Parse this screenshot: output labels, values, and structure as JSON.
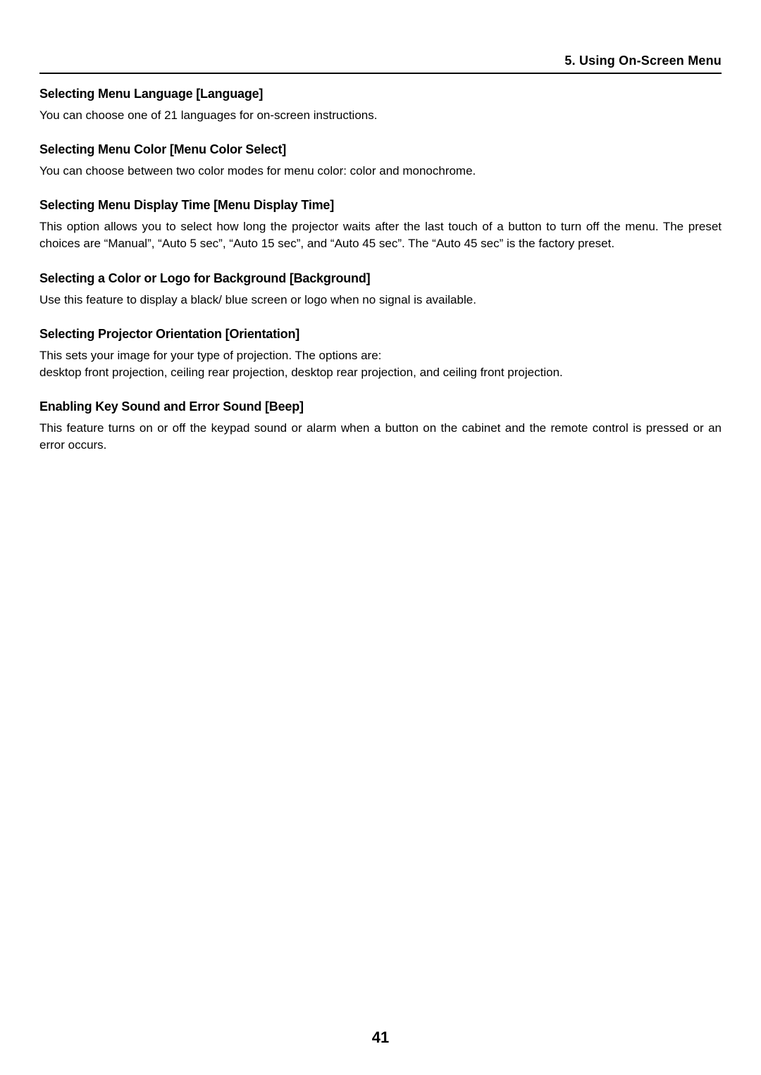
{
  "header": {
    "chapter": "5. Using On-Screen Menu"
  },
  "sections": [
    {
      "heading": "Selecting Menu Language [Language]",
      "body": "You can choose one of 21 languages for on-screen instructions."
    },
    {
      "heading": "Selecting Menu Color [Menu Color Select]",
      "body": "You can choose between two color modes for menu color: color and monochrome."
    },
    {
      "heading": "Selecting Menu Display Time [Menu Display Time]",
      "body": "This option allows you to select how long the projector waits after the last touch of a button to turn off the menu. The preset choices are “Manual”, “Auto 5 sec”, “Auto 15 sec”, and “Auto 45 sec”. The “Auto 45 sec” is the factory preset."
    },
    {
      "heading": "Selecting a Color or Logo for Background [Background]",
      "body": "Use this feature to display a black/ blue screen or logo when no signal is available."
    },
    {
      "heading": "Selecting Projector Orientation [Orientation]",
      "body_line1": "This sets your image for your type of projection. The options are:",
      "body_line2": "desktop front projection, ceiling rear projection, desktop rear projection, and ceiling front projection."
    },
    {
      "heading": "Enabling Key Sound and Error Sound [Beep]",
      "body": "This feature turns on or off the keypad sound or alarm when a button on the cabinet and the remote control is pressed or an error occurs."
    }
  ],
  "page_number": "41"
}
